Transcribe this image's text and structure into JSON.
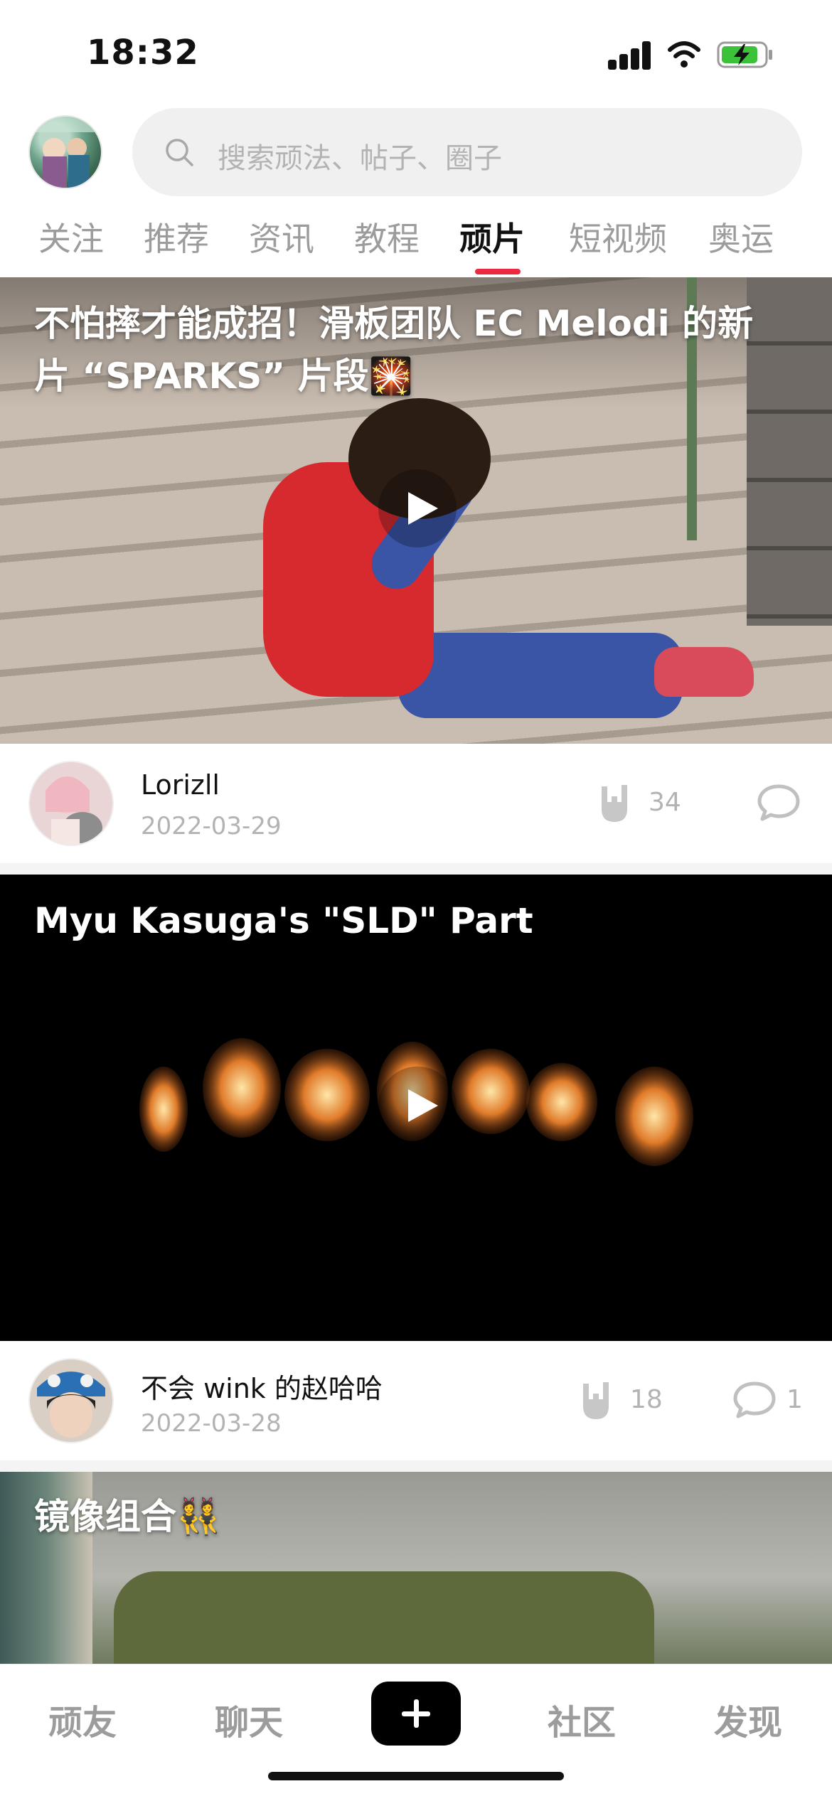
{
  "status_bar": {
    "time": "18:32"
  },
  "search": {
    "placeholder": "搜索顽法、帖子、圈子"
  },
  "tabs": [
    {
      "label": "关注"
    },
    {
      "label": "推荐"
    },
    {
      "label": "资讯"
    },
    {
      "label": "教程"
    },
    {
      "label": "顽片",
      "active": true
    },
    {
      "label": "短视频"
    },
    {
      "label": "奥运"
    }
  ],
  "posts": [
    {
      "title_line1": "不怕摔才能成招！滑板团队 EC Melodi 的新",
      "title_line2": "片 “SPARKS” 片段",
      "title_emoji": "🎇",
      "author": "Lorizll",
      "date": "2022-03-29",
      "likes": "34",
      "comments": ""
    },
    {
      "title": "Myu Kasuga's \"SLD\" Part",
      "author": "不会 wink 的赵哈哈",
      "date": "2022-03-28",
      "likes": "18",
      "comments": "1"
    },
    {
      "title": "镜像组合👯"
    }
  ],
  "bottom_nav": {
    "items": [
      {
        "label": "顽友"
      },
      {
        "label": "聊天"
      },
      {
        "label": "社区"
      },
      {
        "label": "发现"
      }
    ]
  },
  "colors": {
    "accent": "#ec2a3f",
    "text_muted": "#9c9c9c"
  }
}
